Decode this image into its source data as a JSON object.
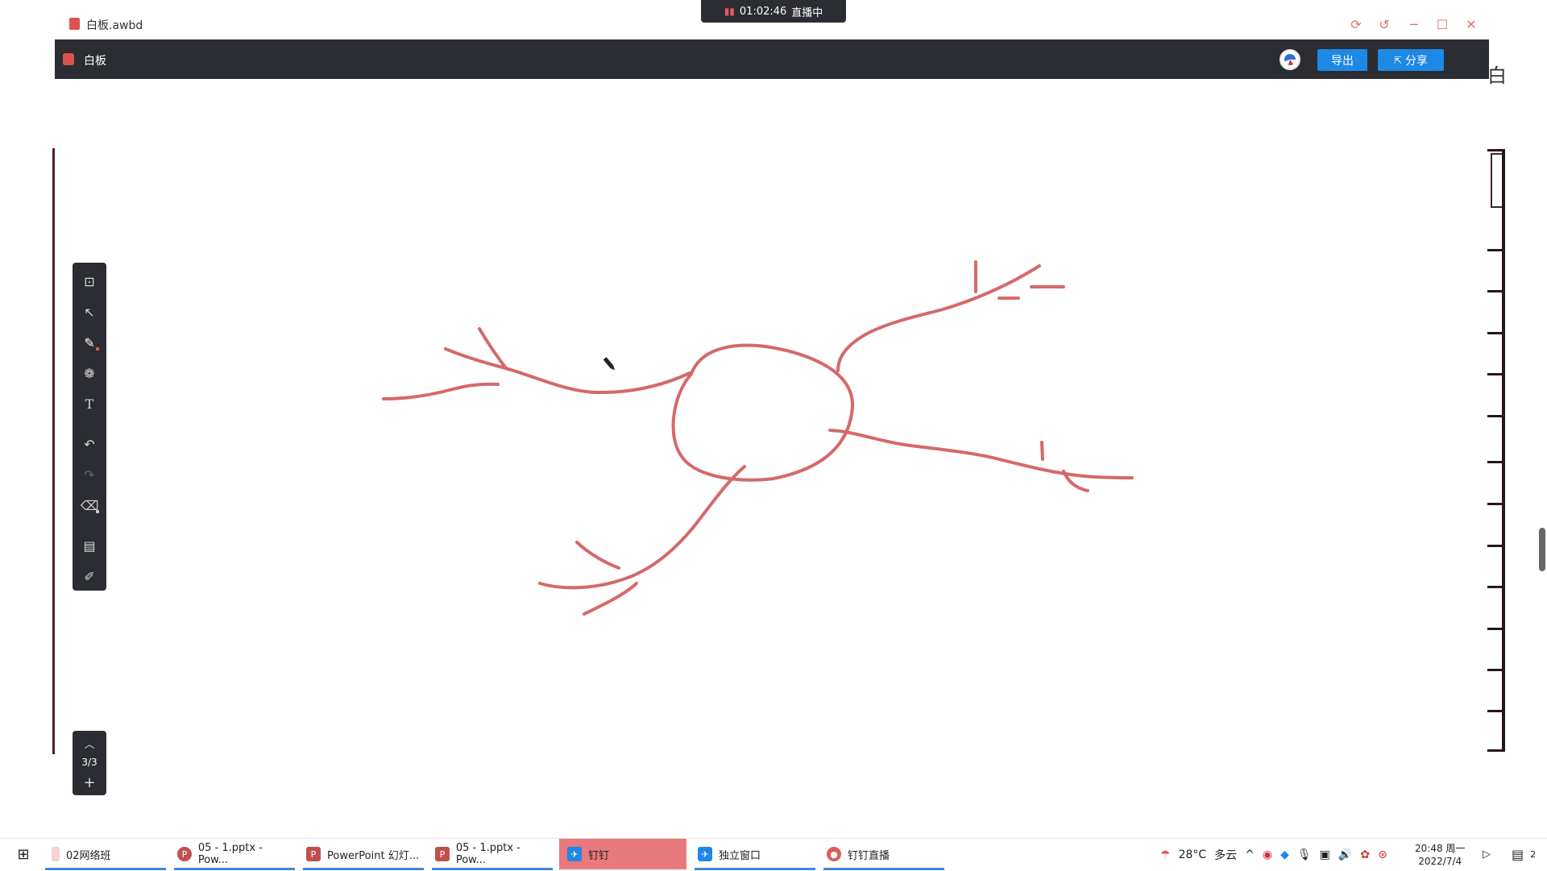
{
  "window": {
    "title": "白板.awbd",
    "live": {
      "timer": "01:02:46",
      "status": "直播中"
    }
  },
  "app": {
    "title": "白板",
    "export_label": "导出",
    "share_label": "分享",
    "partial_char": "白"
  },
  "pager": {
    "current": "3/3"
  },
  "taskbar": {
    "items": [
      {
        "label": "02网络班"
      },
      {
        "label": "05 - 1.pptx - Pow..."
      },
      {
        "label": "PowerPoint 幻灯..."
      },
      {
        "label": "05 - 1.pptx - Pow..."
      },
      {
        "label": "钉钉"
      },
      {
        "label": "独立窗口"
      },
      {
        "label": "钉钉直播"
      }
    ],
    "weather": {
      "temp": "28°C",
      "desc": "多云"
    },
    "clock": {
      "time": "20:48 周一",
      "date": "2022/7/4"
    },
    "notif_count": "2"
  },
  "colors": {
    "ink": "#d4696a",
    "header_bg": "#2b2d33",
    "button_blue": "#1e88e5"
  }
}
